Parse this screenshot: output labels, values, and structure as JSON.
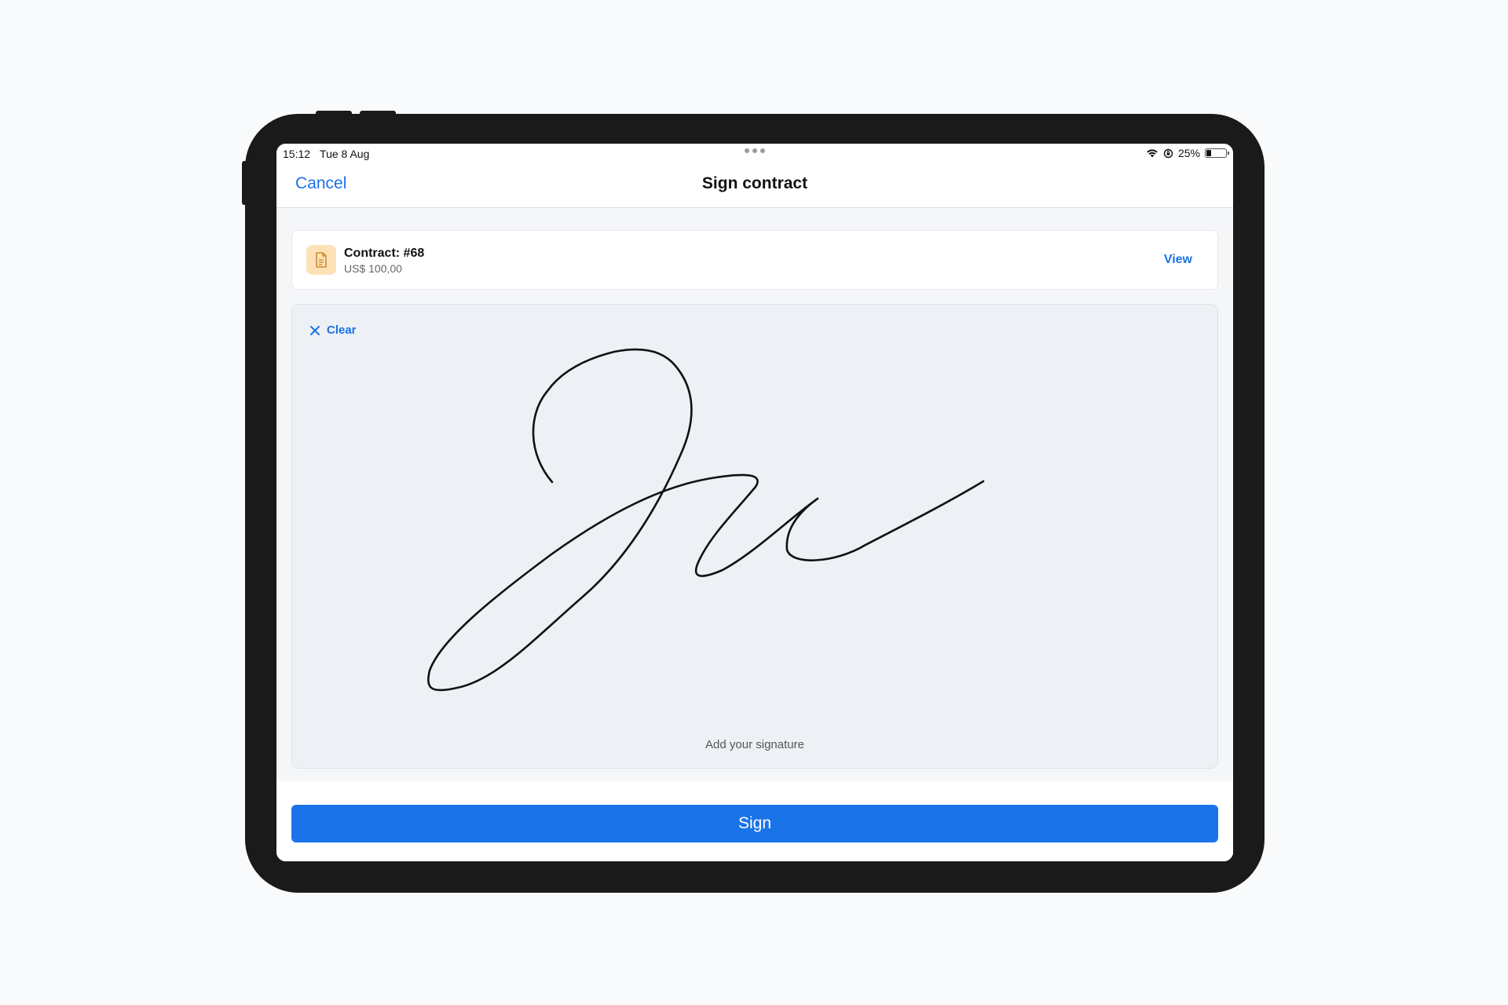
{
  "status_bar": {
    "time": "15:12",
    "date": "Tue 8 Aug",
    "battery_text": "25%",
    "battery_level": 0.25
  },
  "nav": {
    "cancel_label": "Cancel",
    "title": "Sign contract"
  },
  "contract": {
    "title": "Contract: #68",
    "amount": "US$ 100,00",
    "view_label": "View",
    "icon": "document-icon"
  },
  "signature": {
    "clear_label": "Clear",
    "hint": "Add your signature"
  },
  "footer": {
    "sign_label": "Sign"
  },
  "colors": {
    "accent": "#1a73e8",
    "doc_icon_bg": "#fde2b8",
    "doc_icon_fg": "#d08a2e"
  }
}
